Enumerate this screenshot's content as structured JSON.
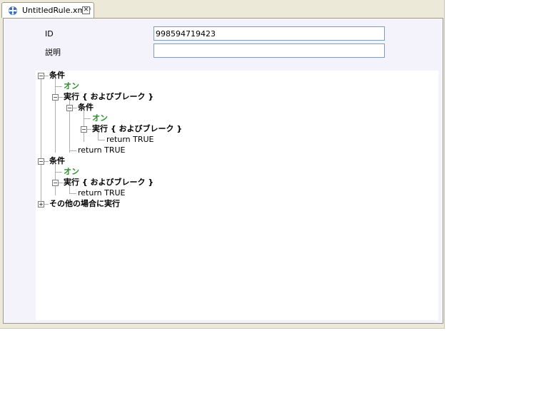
{
  "tab": {
    "title": "UntitledRule.xml*",
    "close": "✕"
  },
  "form": {
    "id_label": "ID",
    "id_value": "998594719423",
    "desc_label": "説明",
    "desc_value": ""
  },
  "tree": {
    "expand_minus": "−",
    "expand_plus": "+",
    "n1": "条件",
    "n1_on": "オン",
    "n1_exec": "実行 { およびブレーク }",
    "n1_sub_cond": "条件",
    "n1_sub_on": "オン",
    "n1_sub_exec": "実行 { およびブレーク }",
    "n1_sub_return": "return TRUE",
    "n1_return": "return TRUE",
    "n2": "条件",
    "n2_on": "オン",
    "n2_exec": "実行 { およびブレーク }",
    "n2_return": "return TRUE",
    "n3": "その他の場合に実行"
  }
}
